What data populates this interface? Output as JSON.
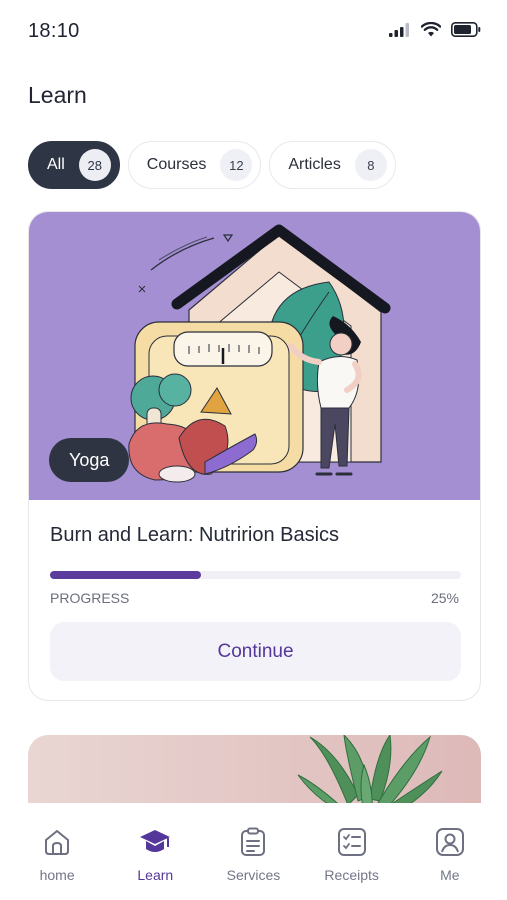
{
  "status": {
    "time": "18:10"
  },
  "page": {
    "title": "Learn"
  },
  "filters": [
    {
      "label": "All",
      "count": "28"
    },
    {
      "label": "Courses",
      "count": "12"
    },
    {
      "label": "Articles",
      "count": "8"
    }
  ],
  "course_card": {
    "tag": "Yoga",
    "title": "Burn and Learn: Nutririon Basics",
    "progress_label": "PROGRESS",
    "progress_value": "25%",
    "progress_fraction": 0.25,
    "button_label": "Continue"
  },
  "tabs": [
    {
      "label": "home",
      "icon": "home-icon"
    },
    {
      "label": "Learn",
      "icon": "graduation-cap-icon"
    },
    {
      "label": "Services",
      "icon": "clipboard-icon"
    },
    {
      "label": "Receipts",
      "icon": "checklist-icon"
    },
    {
      "label": "Me",
      "icon": "user-icon"
    }
  ],
  "colors": {
    "accent": "#55369a",
    "dark": "#2e3544",
    "hero_bg": "#a48fd3"
  }
}
